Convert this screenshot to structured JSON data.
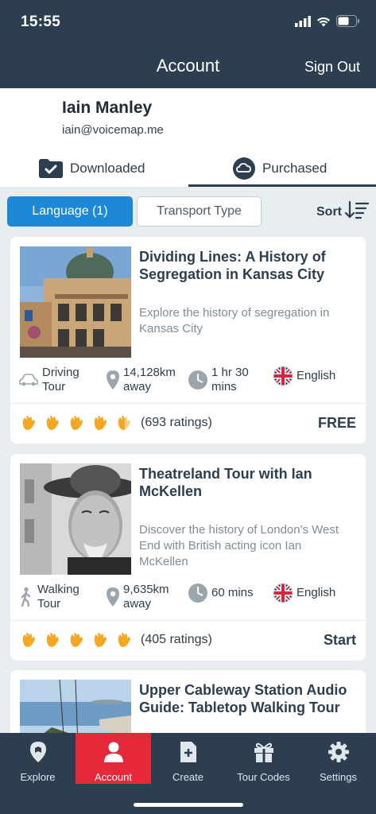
{
  "status_bar": {
    "time": "15:55"
  },
  "header": {
    "title": "Account",
    "sign_out": "Sign Out"
  },
  "profile": {
    "name": "Iain Manley",
    "email": "iain@voicemap.me"
  },
  "tabs": [
    {
      "label": "Downloaded",
      "icon": "folder-check-icon",
      "active": false
    },
    {
      "label": "Purchased",
      "icon": "cloud-icon",
      "active": true
    }
  ],
  "filters": {
    "language": "Language (1)",
    "transport": "Transport Type",
    "sort": "Sort"
  },
  "cards": [
    {
      "title": "Dividing Lines: A History of Segregation in Kansas City",
      "description": "Explore the history of segregation in Kansas City",
      "transport": "Driving Tour",
      "transport_icon": "car-icon",
      "distance": "14,128km away",
      "duration": "1 hr 30 mins",
      "language": "English",
      "ratings": "(693 ratings)",
      "rating_level": 4.5,
      "action": "FREE"
    },
    {
      "title": "Theatreland Tour with Ian McKellen",
      "description": "Discover the history of London's West End with British acting icon Ian McKellen",
      "transport": "Walking Tour",
      "transport_icon": "walking-person-icon",
      "distance": "9,635km away",
      "duration": "60 mins",
      "language": "English",
      "ratings": "(405 ratings)",
      "rating_level": 5,
      "action": "Start"
    },
    {
      "title": "Upper Cableway Station Audio Guide: Tabletop Walking Tour"
    }
  ],
  "bottom_nav": [
    {
      "label": "Explore",
      "icon": "map-pin-icon",
      "active": false
    },
    {
      "label": "Account",
      "icon": "user-icon",
      "active": true
    },
    {
      "label": "Create",
      "icon": "file-plus-icon",
      "active": false
    },
    {
      "label": "Tour Codes",
      "icon": "gift-icon",
      "active": false
    },
    {
      "label": "Settings",
      "icon": "gear-icon",
      "active": false
    }
  ],
  "colors": {
    "header_bg": "#2c3e50",
    "accent_blue": "#1e88d8",
    "active_nav": "#e5283a",
    "clap_orange": "#f5a623"
  }
}
